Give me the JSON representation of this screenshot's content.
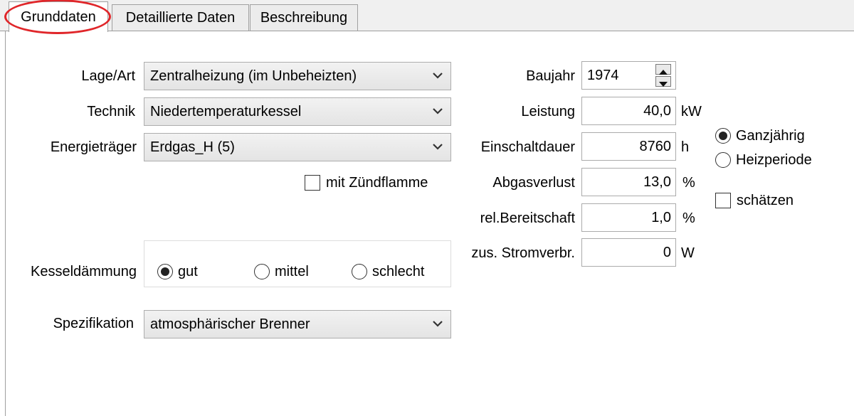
{
  "tabs": [
    {
      "label": "Grunddaten",
      "active": true
    },
    {
      "label": "Detaillierte Daten",
      "active": false
    },
    {
      "label": "Beschreibung",
      "active": false
    }
  ],
  "left": {
    "lage_label": "Lage/Art",
    "lage_value": "Zentralheizung (im Unbeheizten)",
    "technik_label": "Technik",
    "technik_value": "Niedertemperaturkessel",
    "energie_label": "Energieträger",
    "energie_value": "Erdgas_H (5)",
    "zuendflamme_label": "mit Zündflamme",
    "zuendflamme_checked": false,
    "kessel_label": "Kesseldämmung",
    "kessel_options": [
      "gut",
      "mittel",
      "schlecht"
    ],
    "kessel_selected": "gut",
    "spez_label": "Spezifikation",
    "spez_value": "atmosphärischer Brenner"
  },
  "right": {
    "baujahr_label": "Baujahr",
    "baujahr_value": "1974",
    "leistung_label": "Leistung",
    "leistung_value": "40,0",
    "leistung_unit": "kW",
    "einschalt_label": "Einschaltdauer",
    "einschalt_value": "8760",
    "einschalt_unit": "h",
    "abgas_label": "Abgasverlust",
    "abgas_value": "13,0",
    "abgas_unit": "%",
    "bereit_label": "rel.Bereitschaft",
    "bereit_value": "1,0",
    "bereit_unit": "%",
    "strom_label": "zus. Stromverbr.",
    "strom_value": "0",
    "strom_unit": "W",
    "period_options": [
      "Ganzjährig",
      "Heizperiode"
    ],
    "period_selected": "Ganzjährig",
    "schaetzen_label": "schätzen",
    "schaetzen_checked": false
  },
  "colors": {
    "highlight": "#e0262a"
  }
}
